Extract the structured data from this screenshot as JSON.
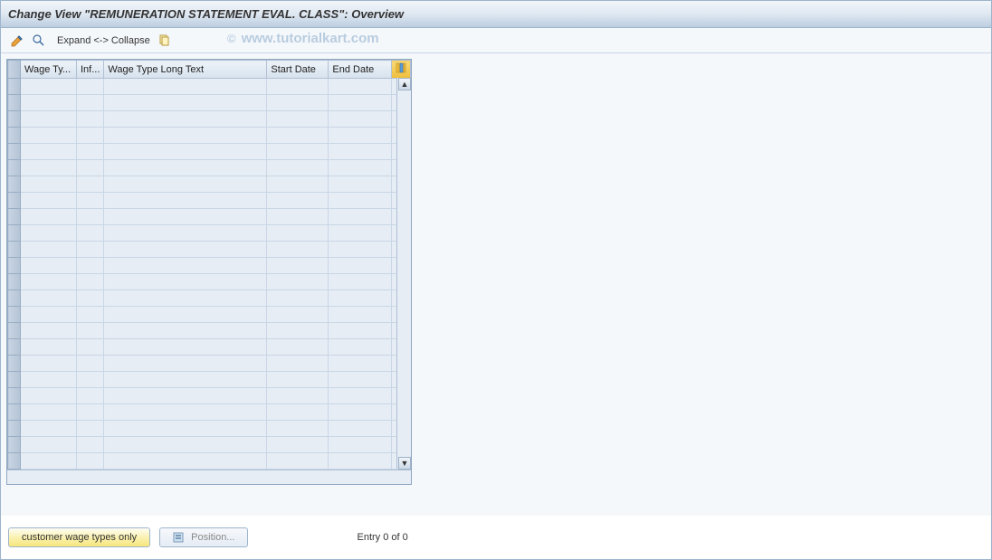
{
  "header": {
    "title": "Change View \"REMUNERATION STATEMENT EVAL. CLASS\": Overview"
  },
  "toolbar": {
    "expand_collapse_label": "Expand <-> Collapse"
  },
  "watermark": {
    "copy": "©",
    "text": "www.tutorialkart.com"
  },
  "table": {
    "columns": {
      "wage_type": "Wage Ty...",
      "inf": "Inf...",
      "long_text": "Wage Type Long Text",
      "start_date": "Start Date",
      "end_date": "End Date"
    },
    "row_count": 24
  },
  "footer": {
    "customer_wage_types_label": "customer wage types only",
    "position_label": "Position...",
    "entry_label": "Entry 0 of 0"
  }
}
